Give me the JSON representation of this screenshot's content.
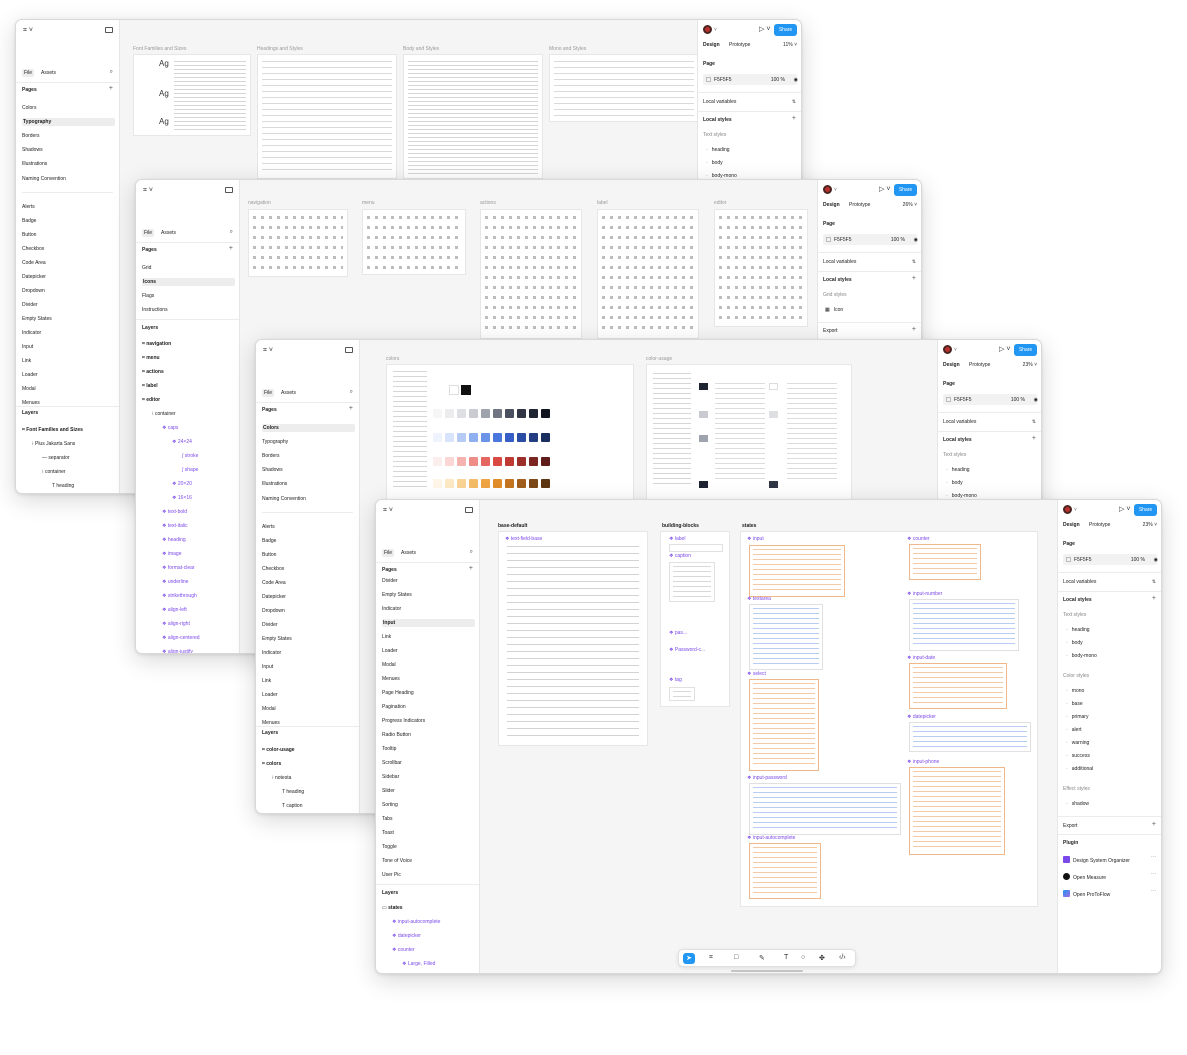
{
  "app": {
    "menu_logo": "⌗ ˅",
    "tabs": {
      "file": "File",
      "assets": "Assets"
    },
    "share": "Share",
    "design_tab": "Design",
    "prototype_tab": "Prototype",
    "page_heading": "Page",
    "page_color": "F5F5F5",
    "page_opacity": "100",
    "percent": "%",
    "pages_heading": "Pages",
    "layers_heading": "Layers",
    "local_variables": "Local variables",
    "local_styles": "Local styles",
    "text_styles": "Text styles",
    "export": "Export",
    "colors": {
      "accent": "#2196f3",
      "layer_purple": "#7b49ea",
      "avatar": "#b9312e"
    },
    "icons": {
      "search": "search-icon",
      "sidebar": "sidebar-toggle-icon",
      "play": "play-icon",
      "eye": "eye-icon",
      "plus": "plus-icon"
    }
  },
  "w1": {
    "zoom": "11%",
    "pages": [
      "Colors",
      "Typography",
      "Borders",
      "Shadows",
      "Illustrations",
      "Naming Convention"
    ],
    "components": [
      "Alerts",
      "Badge",
      "Button",
      "Checkbox",
      "Code Area",
      "Datepicker",
      "Dropdown",
      "Divider",
      "Empty States",
      "Indicator",
      "Input",
      "Link",
      "Loader",
      "Modal",
      "Menues"
    ],
    "layers": [
      "Font Families and Sizes",
      "Plus Jakarta Sans",
      "separator",
      "container",
      "heading"
    ],
    "styles": [
      "heading",
      "body",
      "body-mono"
    ],
    "frames": [
      "Font Families and Sizes",
      "Headings and Styles",
      "Body and Styles",
      "Mono and Styles"
    ]
  },
  "w2": {
    "zoom": "26%",
    "pages": [
      "Grid",
      "Icons",
      "Flags",
      "Instructions"
    ],
    "layers": [
      "navigation",
      "menu",
      "actions",
      "label",
      "editor",
      "container",
      "caps",
      "24×24",
      "stroke",
      "shape",
      "20×20",
      "16×16",
      "text-bold",
      "text-italic",
      "heading",
      "image",
      "format-clear",
      "underline",
      "strikethrough",
      "align-left",
      "align-right",
      "align-centered",
      "align-justify"
    ],
    "grid_styles": "Grid styles",
    "grid_icon": "Icon",
    "frames": [
      "navigation",
      "menu",
      "actions",
      "label",
      "editor"
    ]
  },
  "w3": {
    "zoom": "23%",
    "pages": [
      "Colors",
      "Typography",
      "Borders",
      "Shadows",
      "Illustrations",
      "Naming Convention"
    ],
    "components": [
      "Alerts",
      "Badge",
      "Button",
      "Checkbox",
      "Code Area",
      "Datepicker",
      "Dropdown",
      "Divider",
      "Empty States",
      "Indicator",
      "Input",
      "Link",
      "Loader",
      "Modal",
      "Menues"
    ],
    "layers": [
      "color-usage",
      "colors",
      "notesta",
      "heading",
      "caption"
    ],
    "styles": [
      "heading",
      "body",
      "body-mono"
    ],
    "frames": [
      "colors",
      "color-usage"
    ]
  },
  "w4": {
    "zoom": "23%",
    "pages": [
      "Divider",
      "Empty States",
      "Indicator",
      "Input",
      "Link",
      "Loader",
      "Modal",
      "Menues",
      "Page Heading",
      "Pagination",
      "Progress Indicators",
      "Radio Button",
      "Tooltip",
      "Scrollbar",
      "Sidebar",
      "Slider",
      "Sorting",
      "Tabs",
      "Toast",
      "Toggle",
      "Tone of Voice",
      "User Pic"
    ],
    "layers": [
      "states",
      "input-autocomplete",
      "datepicker",
      "counter",
      "Large, Filled"
    ],
    "text_styles": [
      "heading",
      "body",
      "body-mono"
    ],
    "color_styles_heading": "Color styles",
    "color_styles": [
      "mono",
      "base",
      "primary",
      "alert",
      "warning",
      "success",
      "additional"
    ],
    "effect_styles_heading": "Effect styles",
    "effect_styles": [
      "shadow"
    ],
    "plugin_heading": "Plugin",
    "plugins": [
      "Design System Organizer",
      "Open Measure",
      "Open ProToFlow"
    ],
    "frames": [
      "base-default",
      "building-blocks",
      "states"
    ],
    "components": [
      "text-field-base",
      "label",
      "caption",
      "pas...",
      "Password-c...",
      "tag",
      "input",
      "textarea",
      "select",
      "input-password",
      "input-autocomplete",
      "counter",
      "input-number",
      "input-date",
      "datepicker",
      "input-phone"
    ]
  }
}
